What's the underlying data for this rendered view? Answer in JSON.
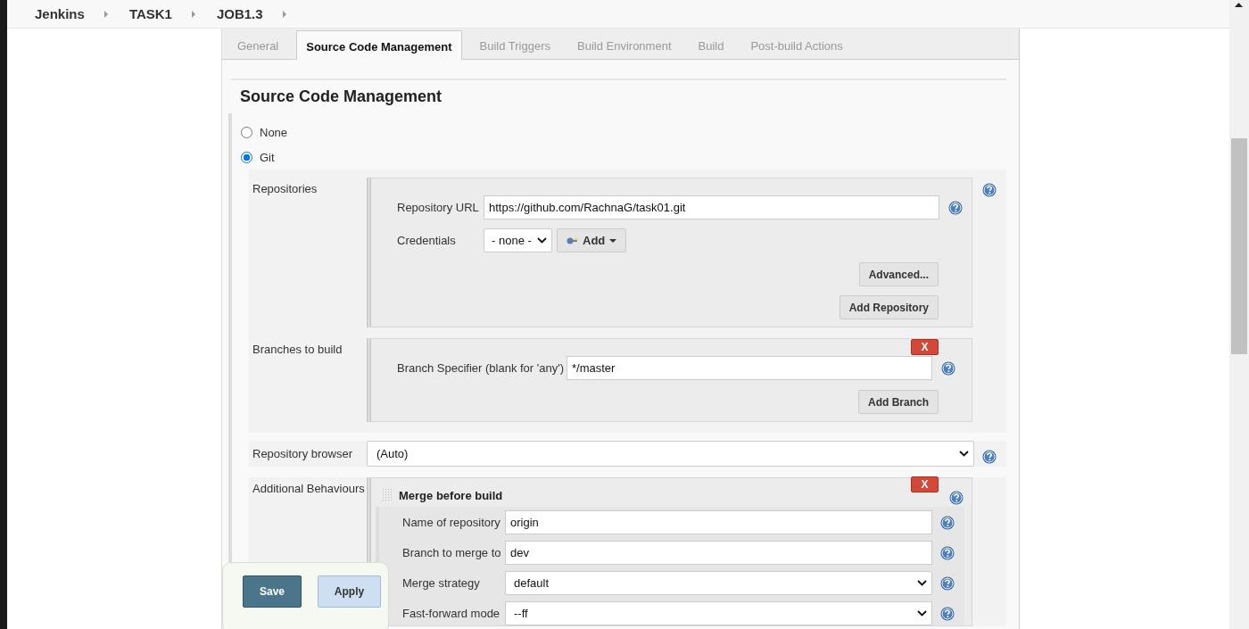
{
  "breadcrumbs": [
    {
      "label": "Jenkins"
    },
    {
      "label": "TASK1"
    },
    {
      "label": "JOB1.3"
    }
  ],
  "tabs": [
    {
      "label": "General",
      "selected": false
    },
    {
      "label": "Source Code Management",
      "selected": true
    },
    {
      "label": "Build Triggers",
      "selected": false
    },
    {
      "label": "Build Environment",
      "selected": false
    },
    {
      "label": "Build",
      "selected": false
    },
    {
      "label": "Post-build Actions",
      "selected": false
    }
  ],
  "section_title": "Source Code Management",
  "scm_options": [
    {
      "label": "None",
      "selected": false
    },
    {
      "label": "Git",
      "selected": true
    }
  ],
  "repositories": {
    "label": "Repositories",
    "fields": [
      {
        "kind": "text",
        "label": "Repository URL",
        "value": "https://github.com/RachnaG/task01.git"
      },
      {
        "kind": "credentials",
        "label": "Credentials",
        "value": "- none -",
        "add_button": "Add"
      }
    ],
    "buttons": [
      "Advanced...",
      "Add Repository"
    ]
  },
  "branches": {
    "label": "Branches to build",
    "delete": "X",
    "field": {
      "label": "Branch Specifier (blank for 'any')",
      "value": "*/master"
    },
    "button": "Add Branch"
  },
  "repository_browser": {
    "label": "Repository browser",
    "value": "(Auto)"
  },
  "additional_behaviours": {
    "label": "Additional Behaviours",
    "title": "Merge before build",
    "delete": "X",
    "fields": [
      {
        "kind": "text",
        "label": "Name of repository",
        "value": "origin"
      },
      {
        "kind": "text",
        "label": "Branch to merge to",
        "value": "dev"
      },
      {
        "kind": "select",
        "label": "Merge strategy",
        "value": "default"
      },
      {
        "kind": "select",
        "label": "Fast-forward mode",
        "value": "--ff"
      }
    ]
  },
  "actions": [
    {
      "label": "Save",
      "kind": "primary"
    },
    {
      "label": "Apply",
      "kind": "secondary"
    }
  ]
}
